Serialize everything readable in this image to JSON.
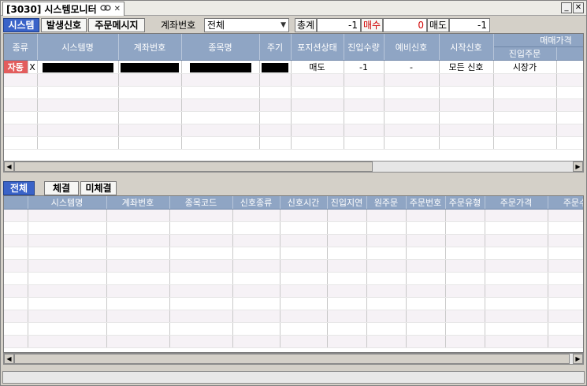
{
  "window": {
    "code": "[3030]",
    "title": "시스템모니터",
    "title_icon": "link-icon",
    "close_glyph": "✕",
    "min_glyph": "_",
    "max_glyph": "✕"
  },
  "toolbar": {
    "tabs": [
      {
        "label": "시스템",
        "active": true
      },
      {
        "label": "발생신호",
        "active": false
      },
      {
        "label": "주문메시지",
        "active": false
      }
    ],
    "account_label": "계좌번호",
    "account_select_value": "전체",
    "total_label": "총계",
    "total_value": "-1",
    "buy_label": "매수",
    "buy_value": "0",
    "sell_label": "매도",
    "sell_value": "-1",
    "colors": {
      "buy": "#d00000",
      "sell": "#0030c0"
    }
  },
  "system_grid": {
    "group_header": "매매가격",
    "columns": [
      "종류",
      "시스템명",
      "계좌번호",
      "종목명",
      "주기",
      "포지션상태",
      "진입수량",
      "예비신호",
      "시작신호",
      "진입주문",
      "청"
    ],
    "rows": [
      {
        "type": "자동",
        "check": "X",
        "system_name": "",
        "account": "",
        "item": "",
        "period": "",
        "position": "매도",
        "qty": "-1",
        "reserve": "-",
        "start": "모든 신호",
        "entry_order": "시장가",
        "extra": "시"
      }
    ]
  },
  "bottom_tabs": [
    {
      "label": "전체",
      "active": true
    },
    {
      "label": "체결",
      "active": false
    },
    {
      "label": "미체결",
      "active": false
    }
  ],
  "order_grid": {
    "columns": [
      "시스템명",
      "계좌번호",
      "종목코드",
      "신호종류",
      "신호시간",
      "진입지연",
      "원주문",
      "주문번호",
      "주문유형",
      "주문가격",
      "주문수"
    ]
  }
}
